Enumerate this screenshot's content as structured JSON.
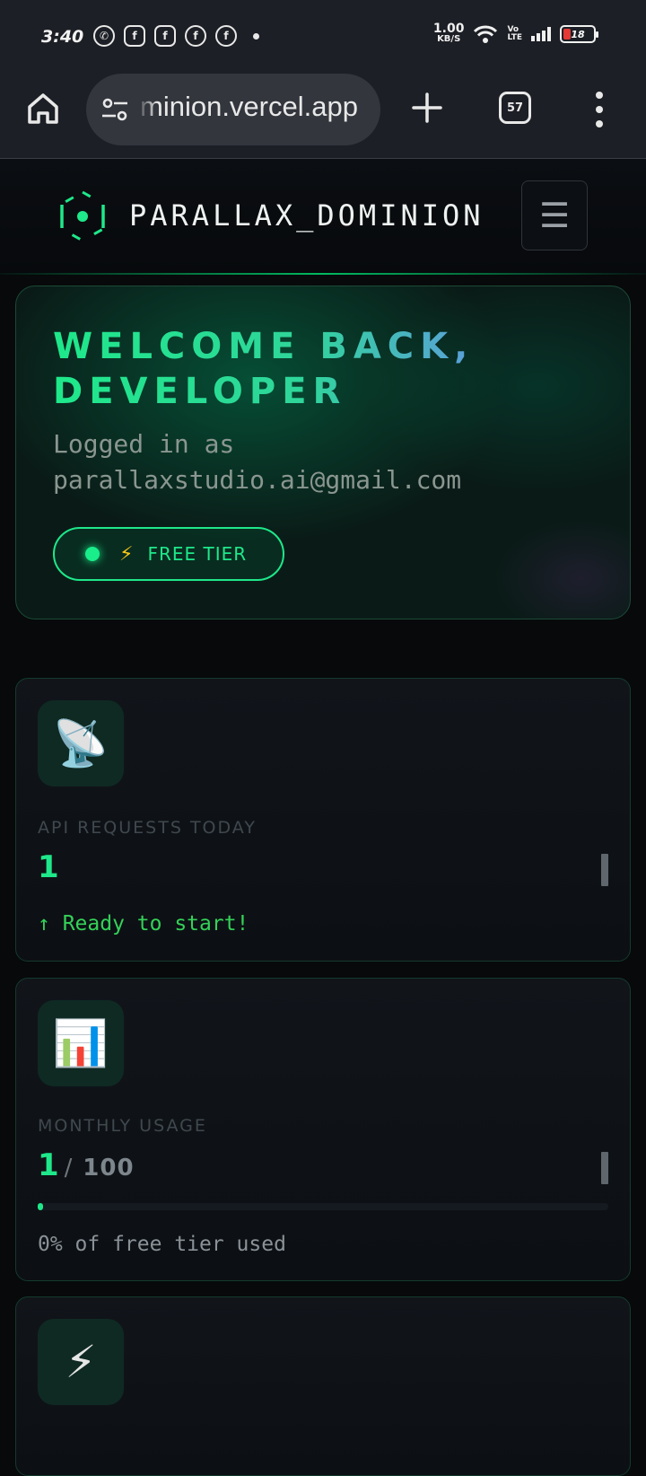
{
  "status_bar": {
    "time": "3:40",
    "net_speed_value": "1.00",
    "net_speed_unit": "KB/S",
    "volte_line1": "Vo",
    "volte_line2": "LTE",
    "battery": "18"
  },
  "browser": {
    "url": "minion.vercel.app",
    "tab_count": "57"
  },
  "header": {
    "brand": "PARALLAX_DOMINION",
    "menu_glyph": "☰"
  },
  "welcome": {
    "title": "WELCOME BACK, DEVELOPER",
    "subtitle": "Logged in as\nparallaxstudio.ai@gmail.com",
    "tier_icon": "⚡",
    "tier_label": "FREE TIER"
  },
  "stats": [
    {
      "icon": "📡",
      "icon_name": "satellite-dish-icon",
      "label": "API REQUESTS TODAY",
      "value": "1",
      "note": "↑ Ready to start!",
      "note_color": "#34d158"
    },
    {
      "icon": "📊",
      "icon_name": "bar-chart-icon",
      "label": "MONTHLY USAGE",
      "value": "1",
      "value_sep": "/",
      "value_total": "100",
      "progress": 0.01,
      "note": "0% of free tier used",
      "note_color": "#8a9298"
    },
    {
      "icon": "⚡",
      "icon_name": "lightning-icon"
    }
  ],
  "colors": {
    "accent": "#1ee88a",
    "background": "#07090b",
    "card_border": "#143a2c"
  }
}
